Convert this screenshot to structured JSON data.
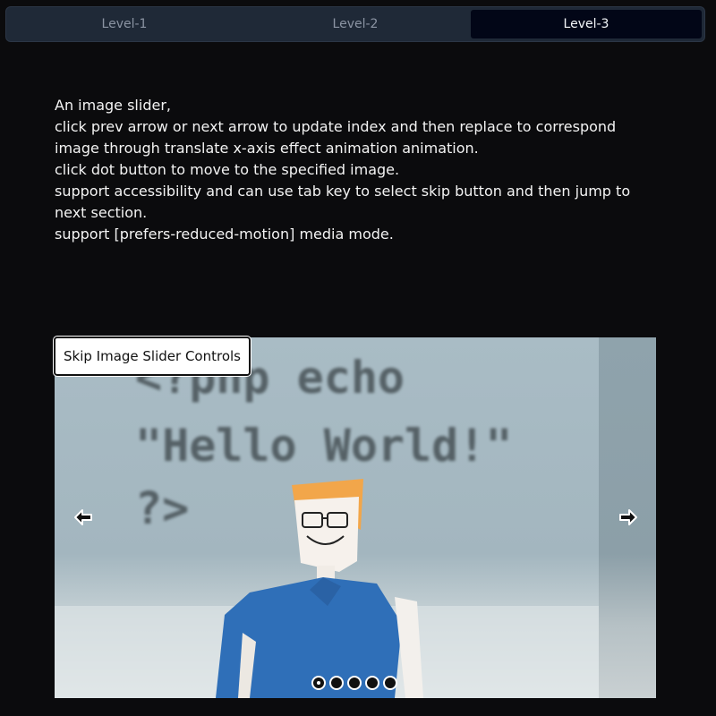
{
  "tabs": [
    {
      "label": "Level-1",
      "active": false
    },
    {
      "label": "Level-2",
      "active": false
    },
    {
      "label": "Level-3",
      "active": true
    }
  ],
  "description": {
    "lines": [
      "An image slider,",
      "click prev arrow or next arrow to update index and then replace to correspond image through translate x-axis effect animation animation.",
      "click dot button to move to the specified image.",
      "support accessibility and can use tab key to select skip button and then jump to next section.",
      "support [prefers-reduced-motion] media mode."
    ]
  },
  "slider": {
    "skip_label": "Skip Image Slider Controls",
    "prev_icon": "arrow-left-icon",
    "next_icon": "arrow-right-icon",
    "dots_count": 5,
    "active_index": 0,
    "image_text": {
      "line1": "<?php echo",
      "line2": "\"Hello World!\"",
      "line3": "?>"
    }
  },
  "colors": {
    "background": "#0b0b0d",
    "tab_bar": "#1f2937",
    "tab_active": "#020617"
  }
}
